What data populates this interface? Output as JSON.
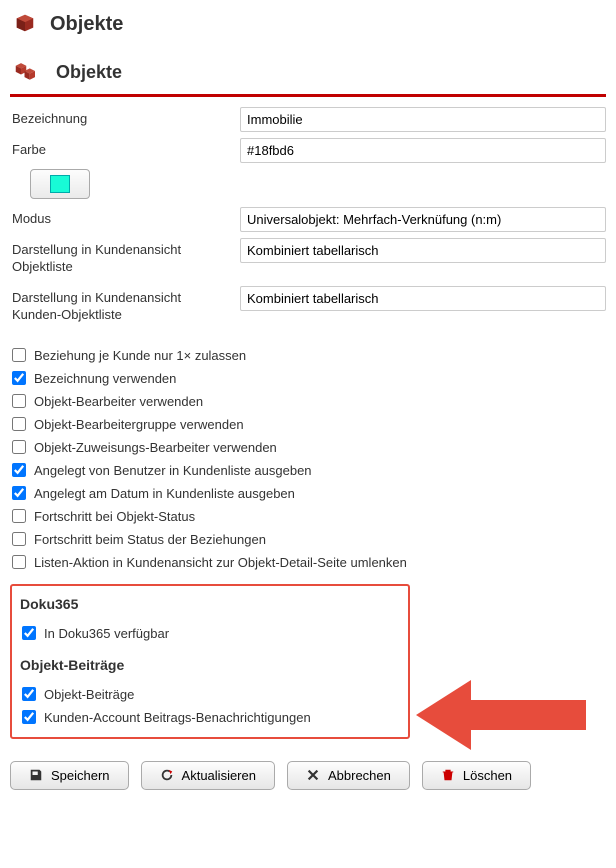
{
  "page": {
    "title": "Objekte"
  },
  "section": {
    "title": "Objekte"
  },
  "fields": {
    "bezeichnung_label": "Bezeichnung",
    "bezeichnung_value": "Immobilie",
    "farbe_label": "Farbe",
    "farbe_value": "#18fbd6",
    "modus_label": "Modus",
    "modus_value": "Universalobjekt: Mehrfach-Verknüfung (n:m)",
    "darstellung1_label": "Darstellung in Kundenansicht Objektliste",
    "darstellung1_value": "Kombiniert tabellarisch",
    "darstellung2_label": "Darstellung in Kundenansicht Kunden-Objektliste",
    "darstellung2_value": "Kombiniert tabellarisch"
  },
  "checks": {
    "c1": {
      "label": "Beziehung je Kunde nur 1× zulassen",
      "checked": false
    },
    "c2": {
      "label": "Bezeichnung verwenden",
      "checked": true
    },
    "c3": {
      "label": "Objekt-Bearbeiter verwenden",
      "checked": false
    },
    "c4": {
      "label": "Objekt-Bearbeitergruppe verwenden",
      "checked": false
    },
    "c5": {
      "label": "Objekt-Zuweisungs-Bearbeiter verwenden",
      "checked": false
    },
    "c6": {
      "label": "Angelegt von Benutzer in Kundenliste ausgeben",
      "checked": true
    },
    "c7": {
      "label": "Angelegt am Datum in Kundenliste ausgeben",
      "checked": true
    },
    "c8": {
      "label": "Fortschritt bei Objekt-Status",
      "checked": false
    },
    "c9": {
      "label": "Fortschritt beim Status der Beziehungen",
      "checked": false
    },
    "c10": {
      "label": "Listen-Aktion in Kundenansicht zur Objekt-Detail-Seite umlenken",
      "checked": false
    }
  },
  "highlight": {
    "doku365_title": "Doku365",
    "doku365_c1": {
      "label": "In Doku365 verfügbar",
      "checked": true
    },
    "beitraege_title": "Objekt-Beiträge",
    "beitraege_c1": {
      "label": "Objekt-Beiträge",
      "checked": true
    },
    "beitraege_c2": {
      "label": "Kunden-Account Beitrags-Benachrichtigungen",
      "checked": true
    }
  },
  "buttons": {
    "save": "Speichern",
    "refresh": "Aktualisieren",
    "cancel": "Abbrechen",
    "delete": "Löschen"
  }
}
